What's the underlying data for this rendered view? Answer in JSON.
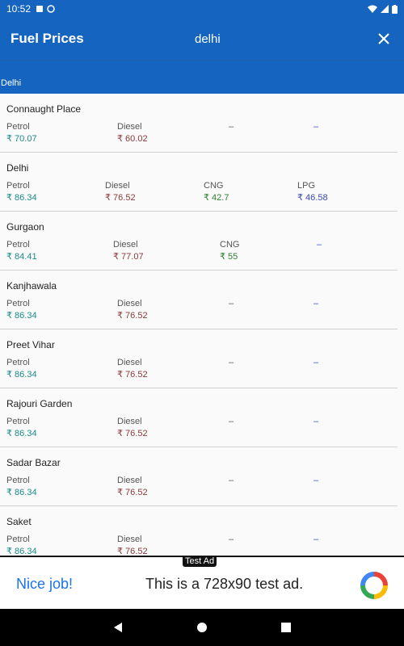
{
  "status_bar": {
    "time": "10:52"
  },
  "app_bar": {
    "title": "Fuel Prices",
    "search_value": "delhi"
  },
  "section": {
    "header": "Delhi"
  },
  "fuel_labels": {
    "petrol": "Petrol",
    "diesel": "Diesel",
    "cng": "CNG",
    "lpg": "LPG",
    "dash": "–"
  },
  "items": [
    {
      "city": "Connaught Place",
      "petrol": "₹ 70.07",
      "diesel": "₹ 60.02"
    },
    {
      "city": "Delhi",
      "petrol": "₹ 86.34",
      "diesel": "₹ 76.52",
      "cng": "₹ 42.7",
      "lpg": "₹ 46.58"
    },
    {
      "city": "Gurgaon",
      "petrol": "₹ 84.41",
      "diesel": "₹ 77.07",
      "cng": "₹ 55"
    },
    {
      "city": "Kanjhawala",
      "petrol": "₹ 86.34",
      "diesel": "₹ 76.52"
    },
    {
      "city": "Preet Vihar",
      "petrol": "₹ 86.34",
      "diesel": "₹ 76.52"
    },
    {
      "city": "Rajouri Garden",
      "petrol": "₹ 86.34",
      "diesel": "₹ 76.52"
    },
    {
      "city": "Sadar Bazar",
      "petrol": "₹ 86.34",
      "diesel": "₹ 76.52"
    },
    {
      "city": "Saket",
      "petrol": "₹ 86.34",
      "diesel": "₹ 76.52"
    }
  ],
  "ad": {
    "tag": "Test Ad",
    "left_text": "Nice job!",
    "right_text": "This is a 728x90 test ad."
  },
  "colors": {
    "primary": "#1565c0",
    "petrol": "#1b8a86",
    "diesel": "#8b3a3a",
    "cng": "#2e7d32",
    "lpg": "#3949ab"
  }
}
